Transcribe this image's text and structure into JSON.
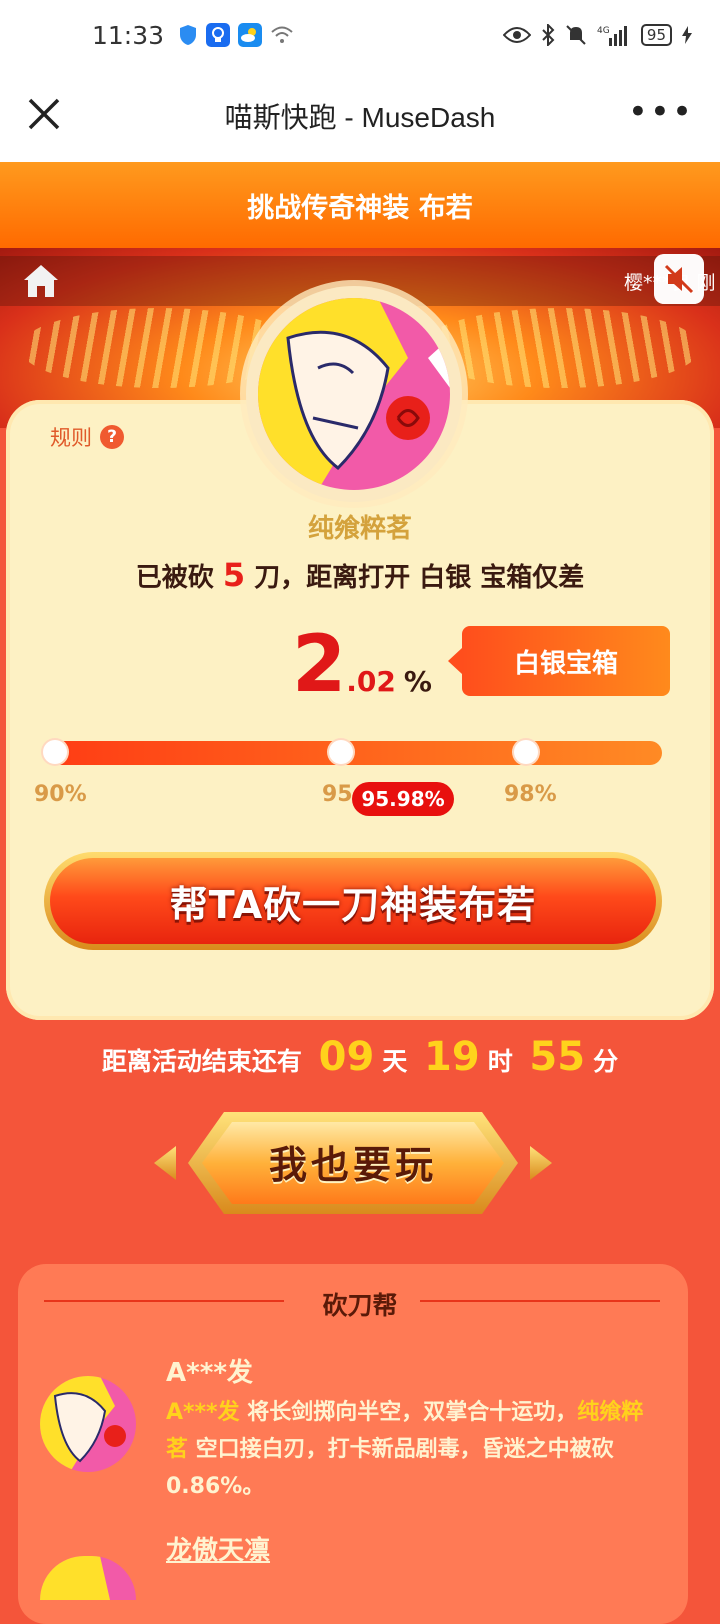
{
  "status_bar": {
    "time": "11:33",
    "battery": "95"
  },
  "nav": {
    "title": "喵斯快跑 - MuseDash",
    "more": "•••"
  },
  "banner": {
    "text": "挑战传奇神装 布若"
  },
  "hero": {
    "ticker": "樱***良 刚"
  },
  "card": {
    "rules_label": "规则",
    "rules_q": "?",
    "owner_name": "纯飨粹茗",
    "status_prefix": "已被砍",
    "status_count": "5",
    "status_suffix": "刀，距离打开 白银 宝箱仅差",
    "remaining_int": "2",
    "remaining_dec": ".02",
    "remaining_sym": "%",
    "chest_label": "白银宝箱",
    "ticks": [
      "90%",
      "95",
      "98%"
    ],
    "current_pct": "95.98%",
    "help_button": "帮TA砍一刀神装布若"
  },
  "progress": {
    "current": 95.98,
    "milestones": [
      90,
      95,
      98
    ]
  },
  "countdown": {
    "prefix": "距离活动结束还有",
    "days": "09",
    "days_unit": "天",
    "hours": "19",
    "hours_unit": "时",
    "minutes": "55",
    "minutes_unit": "分"
  },
  "play_button": "我也要玩",
  "helpers": {
    "title": "砍刀帮",
    "items": [
      {
        "name": "A***发",
        "msg_name": "A***发",
        "msg_part1": " 将长剑掷向半空，双掌合十运功，",
        "msg_target": "纯飨粹茗",
        "msg_part2": " 空口接白刃，打卡新品剧毒，昏迷之中被砍 0.86%。"
      },
      {
        "name": "龙傲天凛"
      }
    ]
  },
  "colors": {
    "accent": "#ff6a00",
    "card_bg": "#fdf1c4",
    "page_bg": "#f4553a",
    "highlight": "#ffd21c"
  }
}
